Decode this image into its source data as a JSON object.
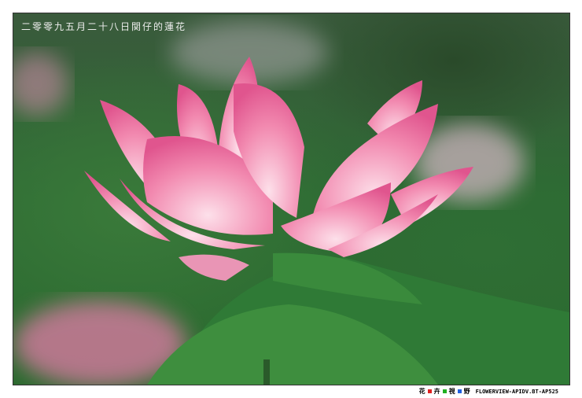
{
  "caption": "二零零九五月二十八日関仔的蓮花",
  "footer": {
    "chars": [
      "花",
      "卉",
      "視",
      "野"
    ],
    "square_colors": [
      "#e02020",
      "#20b020",
      "#2060e0"
    ],
    "site": "FLOWERVIEW-APIDV.BT-AP525"
  }
}
